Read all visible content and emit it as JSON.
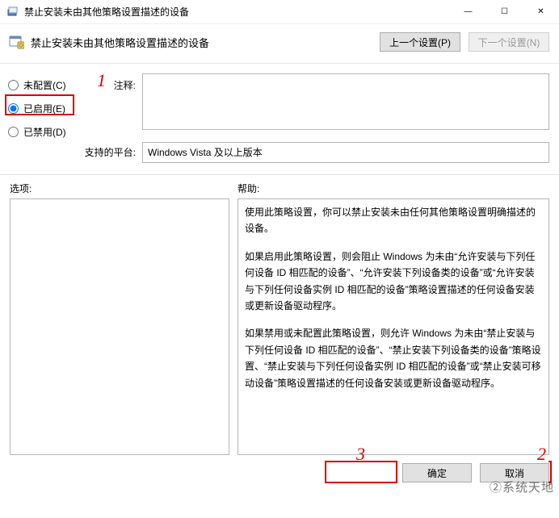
{
  "window": {
    "title": "禁止安装未由其他策略设置描述的设备"
  },
  "header": {
    "policy_name": "禁止安装未由其他策略设置描述的设备",
    "prev_label": "上一个设置(P)",
    "next_label": "下一个设置(N)"
  },
  "radios": {
    "not_configured": "未配置(C)",
    "enabled": "已启用(E)",
    "disabled": "已禁用(D)",
    "selected": "enabled"
  },
  "labels": {
    "comment": "注释:",
    "supported": "支持的平台:",
    "options": "选项:",
    "help": "帮助:"
  },
  "comment_text": "",
  "supported_text": "Windows Vista 及以上版本",
  "help_paragraphs": [
    "使用此策略设置，你可以禁止安装未由任何其他策略设置明确描述的设备。",
    "如果启用此策略设置，则会阻止 Windows 为未由“允许安装与下列任何设备 ID 相匹配的设备”、“允许安装下列设备类的设备”或“允许安装与下列任何设备实例 ID 相匹配的设备”策略设置描述的任何设备安装或更新设备驱动程序。",
    "如果禁用或未配置此策略设置，则允许 Windows 为未由“禁止安装与下列任何设备 ID 相匹配的设备”、“禁止安装下列设备类的设备”策略设置、“禁止安装与下列任何设备实例 ID 相匹配的设备”或“禁止安装可移动设备”策略设置描述的任何设备安装或更新设备驱动程序。"
  ],
  "footer": {
    "ok": "确定",
    "cancel": "取消"
  },
  "annotations": {
    "a1": "1",
    "a2": "2",
    "a3": "3"
  },
  "watermark": "②系统天地"
}
